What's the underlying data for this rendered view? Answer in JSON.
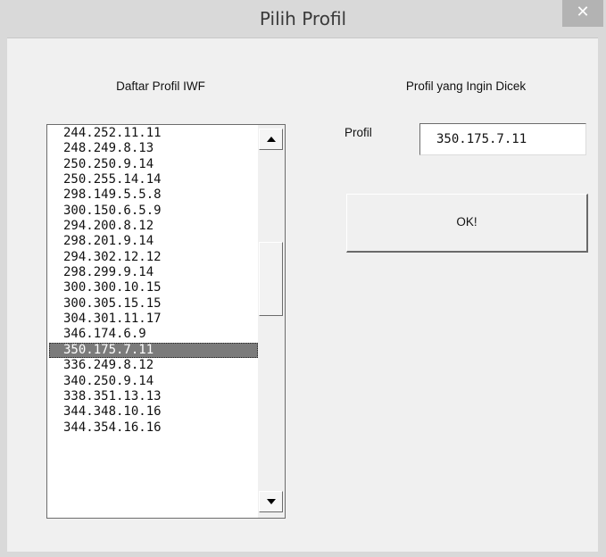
{
  "window": {
    "title": "Pilih Profil",
    "close_glyph": "✕"
  },
  "labels": {
    "daftar": "Daftar Profil IWF",
    "cek": "Profil yang Ingin Dicek",
    "profil": "Profil"
  },
  "listbox": {
    "items": [
      "244.252.11.11",
      "248.249.8.13",
      "250.250.9.14",
      "250.255.14.14",
      "298.149.5.5.8",
      "300.150.6.5.9",
      "294.200.8.12",
      "298.201.9.14",
      "294.302.12.12",
      "298.299.9.14",
      "300.300.10.15",
      "300.305.15.15",
      "304.301.11.17",
      "346.174.6.9",
      "350.175.7.11",
      "336.249.8.12",
      "340.250.9.14",
      "338.351.13.13",
      "344.348.10.16",
      "344.354.16.16"
    ],
    "selected_index": 14
  },
  "input": {
    "value": "350.175.7.11"
  },
  "buttons": {
    "ok_label": "OK!"
  }
}
